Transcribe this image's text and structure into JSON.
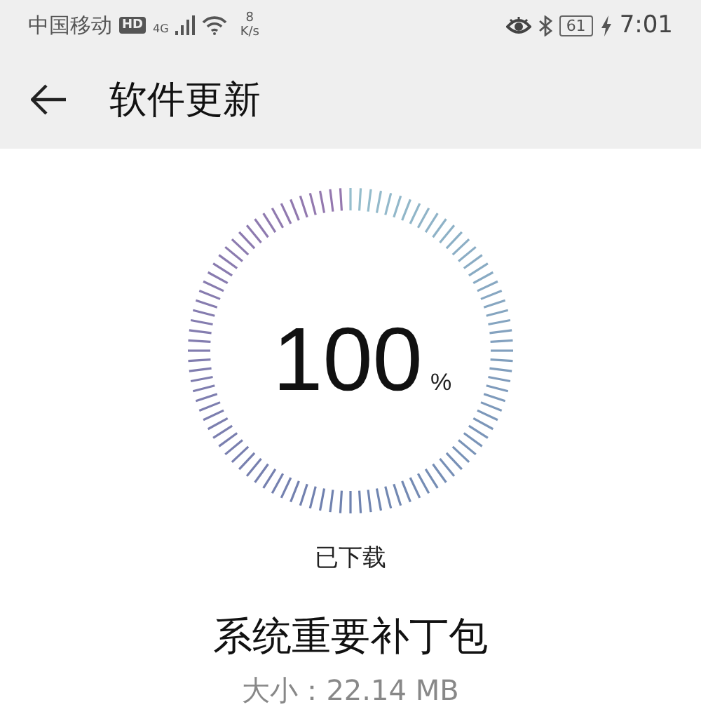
{
  "status_bar": {
    "carrier": "中国移动",
    "hd": "HD",
    "network": "4G",
    "speed_value": "8",
    "speed_unit": "K/s",
    "battery": "61",
    "time": "7:01"
  },
  "header": {
    "title": "软件更新"
  },
  "progress": {
    "value": "100",
    "unit": "%",
    "status": "已下载"
  },
  "update": {
    "name": "系统重要补丁包",
    "size": "大小：22.14 MB"
  }
}
